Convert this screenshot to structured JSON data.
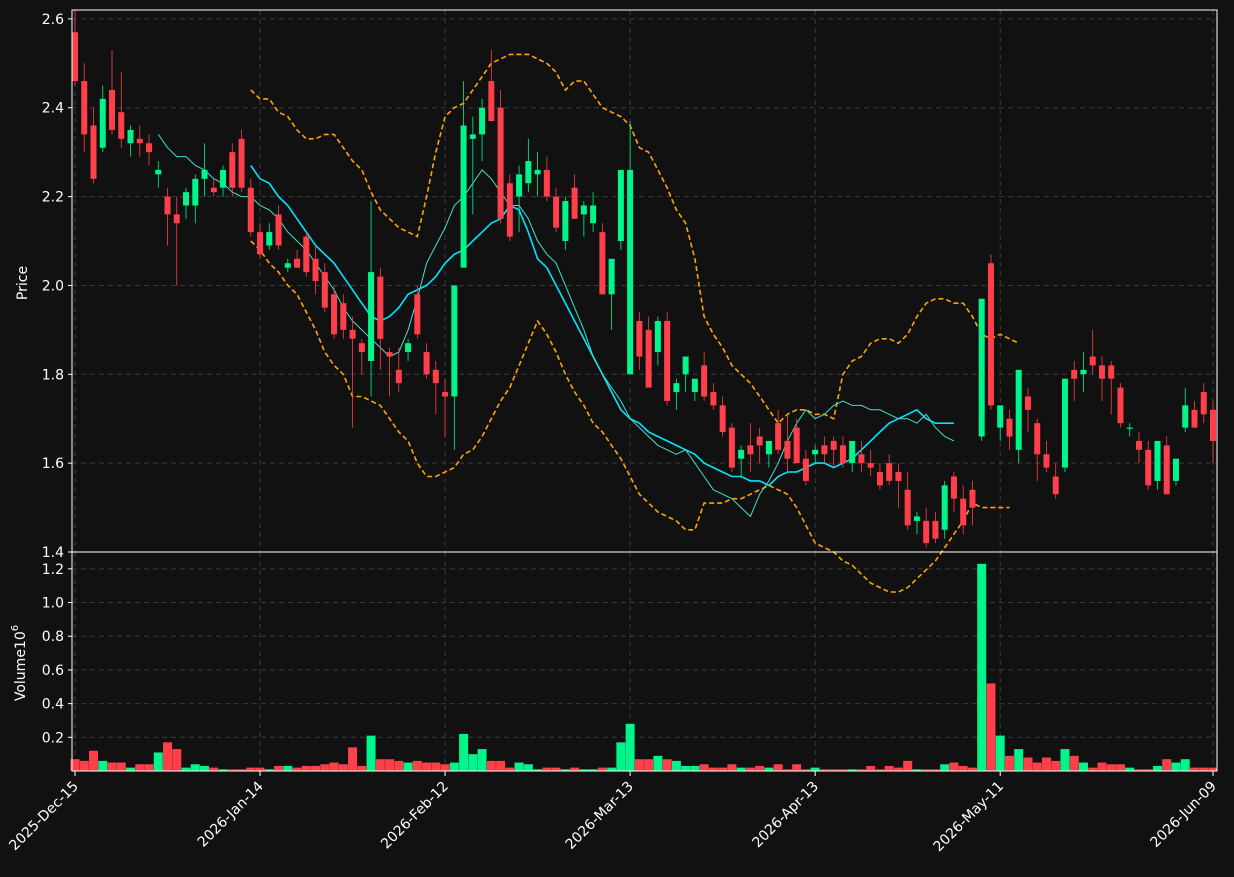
{
  "chart_data": {
    "type": "candlestick",
    "price_panel": {
      "ylabel": "Price",
      "ylim": [
        1.4,
        2.62
      ],
      "yticks": [
        "1.4",
        "1.6",
        "1.8",
        "2.0",
        "2.2",
        "2.4",
        "2.6"
      ],
      "grid": true
    },
    "volume_panel": {
      "ylabel": "Volume",
      "ylabel_exponent": "6",
      "ylim": [
        0,
        1.3
      ],
      "yticks": [
        "0.2",
        "0.4",
        "0.6",
        "0.8",
        "1.0",
        "1.2"
      ],
      "grid": true
    },
    "xtick_labels": [
      "2025-Dec-15",
      "2026-Jan-14",
      "2026-Feb-12",
      "2026-Mar-13",
      "2026-Apr-13",
      "2026-May-11",
      "2026-Jun-09"
    ],
    "xtick_indices": [
      0,
      20,
      40,
      60,
      80,
      100,
      123
    ],
    "candles": [
      [
        2.57,
        2.62,
        2.45,
        2.46,
        0.07
      ],
      [
        2.46,
        2.5,
        2.3,
        2.34,
        0.06
      ],
      [
        2.36,
        2.4,
        2.23,
        2.24,
        0.12
      ],
      [
        2.31,
        2.45,
        2.3,
        2.42,
        0.06
      ],
      [
        2.44,
        2.53,
        2.34,
        2.35,
        0.05
      ],
      [
        2.39,
        2.48,
        2.31,
        2.33,
        0.05
      ],
      [
        2.32,
        2.36,
        2.29,
        2.35,
        0.02
      ],
      [
        2.33,
        2.36,
        2.29,
        2.32,
        0.04
      ],
      [
        2.32,
        2.34,
        2.27,
        2.3,
        0.04
      ],
      [
        2.25,
        2.28,
        2.22,
        2.26,
        0.11
      ],
      [
        2.2,
        2.22,
        2.09,
        2.16,
        0.17
      ],
      [
        2.16,
        2.2,
        2.0,
        2.14,
        0.13
      ],
      [
        2.18,
        2.22,
        2.15,
        2.21,
        0.02
      ],
      [
        2.18,
        2.25,
        2.14,
        2.24,
        0.04
      ],
      [
        2.24,
        2.32,
        2.2,
        2.26,
        0.03
      ],
      [
        2.22,
        2.24,
        2.2,
        2.21,
        0.02
      ],
      [
        2.22,
        2.27,
        2.2,
        2.26,
        0.01
      ],
      [
        2.3,
        2.32,
        2.2,
        2.22,
        0.01
      ],
      [
        2.33,
        2.35,
        2.21,
        2.22,
        0.01
      ],
      [
        2.22,
        2.24,
        2.11,
        2.12,
        0.02
      ],
      [
        2.12,
        2.14,
        2.06,
        2.07,
        0.02
      ],
      [
        2.09,
        2.14,
        2.08,
        2.12,
        0.01
      ],
      [
        2.16,
        2.18,
        2.08,
        2.09,
        0.03
      ],
      [
        2.04,
        2.06,
        2.03,
        2.05,
        0.03
      ],
      [
        2.06,
        2.08,
        2.04,
        2.04,
        0.02
      ],
      [
        2.11,
        2.12,
        2.02,
        2.03,
        0.03
      ],
      [
        2.06,
        2.09,
        1.98,
        2.01,
        0.03
      ],
      [
        2.03,
        2.05,
        1.94,
        1.95,
        0.04
      ],
      [
        1.98,
        2.0,
        1.88,
        1.89,
        0.05
      ],
      [
        1.96,
        1.98,
        1.88,
        1.9,
        0.04
      ],
      [
        1.9,
        1.93,
        1.68,
        1.88,
        0.14
      ],
      [
        1.87,
        1.88,
        1.8,
        1.85,
        0.03
      ],
      [
        1.83,
        2.19,
        1.75,
        2.03,
        0.21
      ],
      [
        2.02,
        2.04,
        1.81,
        1.88,
        0.07
      ],
      [
        1.85,
        1.86,
        1.75,
        1.84,
        0.07
      ],
      [
        1.81,
        1.86,
        1.76,
        1.78,
        0.06
      ],
      [
        1.85,
        1.88,
        1.83,
        1.87,
        0.05
      ],
      [
        1.98,
        2.0,
        1.88,
        1.89,
        0.06
      ],
      [
        1.85,
        1.87,
        1.79,
        1.8,
        0.05
      ],
      [
        1.81,
        1.83,
        1.71,
        1.78,
        0.05
      ],
      [
        1.76,
        1.79,
        1.66,
        1.75,
        0.04
      ],
      [
        1.75,
        2.0,
        1.63,
        2.0,
        0.05
      ],
      [
        2.04,
        2.46,
        2.04,
        2.36,
        0.22
      ],
      [
        2.33,
        2.38,
        2.16,
        2.34,
        0.1
      ],
      [
        2.34,
        2.42,
        2.28,
        2.4,
        0.13
      ],
      [
        2.46,
        2.53,
        2.4,
        2.37,
        0.06
      ],
      [
        2.4,
        2.44,
        2.14,
        2.15,
        0.06
      ],
      [
        2.23,
        2.25,
        2.1,
        2.11,
        0.02
      ],
      [
        2.2,
        2.27,
        2.12,
        2.25,
        0.05
      ],
      [
        2.23,
        2.33,
        2.21,
        2.28,
        0.04
      ],
      [
        2.25,
        2.3,
        2.2,
        2.26,
        0.01
      ],
      [
        2.26,
        2.29,
        2.19,
        2.2,
        0.02
      ],
      [
        2.2,
        2.22,
        2.12,
        2.13,
        0.02
      ],
      [
        2.1,
        2.2,
        2.08,
        2.19,
        0.01
      ],
      [
        2.22,
        2.25,
        2.15,
        2.15,
        0.02
      ],
      [
        2.16,
        2.19,
        2.11,
        2.18,
        0.01
      ],
      [
        2.14,
        2.21,
        2.12,
        2.18,
        0.01
      ],
      [
        2.12,
        2.14,
        1.99,
        1.98,
        0.02
      ],
      [
        1.98,
        2.0,
        1.9,
        2.06,
        0.02
      ],
      [
        2.1,
        2.18,
        2.08,
        2.26,
        0.17
      ],
      [
        1.8,
        2.37,
        1.8,
        2.26,
        0.28
      ],
      [
        1.92,
        1.94,
        1.81,
        1.84,
        0.07
      ],
      [
        1.9,
        1.93,
        1.78,
        1.77,
        0.07
      ],
      [
        1.85,
        1.93,
        1.82,
        1.92,
        0.09
      ],
      [
        1.92,
        1.94,
        1.73,
        1.74,
        0.07
      ],
      [
        1.76,
        1.79,
        1.72,
        1.78,
        0.06
      ],
      [
        1.8,
        1.84,
        1.76,
        1.84,
        0.03
      ],
      [
        1.76,
        1.78,
        1.74,
        1.79,
        0.03
      ],
      [
        1.82,
        1.85,
        1.74,
        1.75,
        0.04
      ],
      [
        1.76,
        1.78,
        1.72,
        1.73,
        0.02
      ],
      [
        1.73,
        1.75,
        1.66,
        1.67,
        0.02
      ],
      [
        1.68,
        1.69,
        1.58,
        1.59,
        0.04
      ],
      [
        1.61,
        1.64,
        1.57,
        1.63,
        0.02
      ],
      [
        1.64,
        1.69,
        1.58,
        1.62,
        0.02
      ],
      [
        1.66,
        1.68,
        1.6,
        1.64,
        0.03
      ],
      [
        1.62,
        1.65,
        1.59,
        1.65,
        0.02
      ],
      [
        1.69,
        1.72,
        1.62,
        1.63,
        0.04
      ],
      [
        1.65,
        1.71,
        1.58,
        1.61,
        0.01
      ],
      [
        1.68,
        1.7,
        1.6,
        1.6,
        0.04
      ],
      [
        1.61,
        1.63,
        1.55,
        1.56,
        0.01
      ],
      [
        1.62,
        1.64,
        1.6,
        1.63,
        0.02
      ],
      [
        1.64,
        1.66,
        1.6,
        1.62,
        0.01
      ],
      [
        1.65,
        1.66,
        1.59,
        1.63,
        0.01
      ],
      [
        1.64,
        1.66,
        1.59,
        1.6,
        0.01
      ],
      [
        1.6,
        1.64,
        1.58,
        1.65,
        0.01
      ],
      [
        1.62,
        1.65,
        1.58,
        1.6,
        0.01
      ],
      [
        1.6,
        1.63,
        1.57,
        1.59,
        0.03
      ],
      [
        1.58,
        1.6,
        1.54,
        1.55,
        0.01
      ],
      [
        1.6,
        1.62,
        1.55,
        1.56,
        0.03
      ],
      [
        1.58,
        1.6,
        1.5,
        1.56,
        0.02
      ],
      [
        1.54,
        1.58,
        1.45,
        1.46,
        0.06
      ],
      [
        1.47,
        1.49,
        1.44,
        1.48,
        0.01
      ],
      [
        1.47,
        1.5,
        1.41,
        1.42,
        0.01
      ],
      [
        1.47,
        1.49,
        1.42,
        1.43,
        0.01
      ],
      [
        1.45,
        1.56,
        1.43,
        1.55,
        0.04
      ],
      [
        1.57,
        1.58,
        1.49,
        1.52,
        0.05
      ],
      [
        1.52,
        1.55,
        1.44,
        1.46,
        0.03
      ],
      [
        1.54,
        1.56,
        1.46,
        1.5,
        0.02
      ],
      [
        1.66,
        1.97,
        1.65,
        1.97,
        1.23
      ],
      [
        2.05,
        2.07,
        1.72,
        1.73,
        0.52
      ],
      [
        1.68,
        1.73,
        1.65,
        1.73,
        0.21
      ],
      [
        1.7,
        1.72,
        1.63,
        1.66,
        0.09
      ],
      [
        1.63,
        1.81,
        1.6,
        1.81,
        0.13
      ],
      [
        1.75,
        1.77,
        1.67,
        1.72,
        0.08
      ],
      [
        1.69,
        1.7,
        1.56,
        1.62,
        0.05
      ],
      [
        1.62,
        1.65,
        1.58,
        1.59,
        0.08
      ],
      [
        1.57,
        1.6,
        1.52,
        1.53,
        0.06
      ],
      [
        1.59,
        1.79,
        1.58,
        1.79,
        0.13
      ],
      [
        1.81,
        1.83,
        1.74,
        1.79,
        0.09
      ],
      [
        1.8,
        1.85,
        1.76,
        1.81,
        0.05
      ],
      [
        1.84,
        1.9,
        1.8,
        1.82,
        0.02
      ],
      [
        1.82,
        1.84,
        1.74,
        1.79,
        0.05
      ],
      [
        1.82,
        1.83,
        1.71,
        1.79,
        0.04
      ],
      [
        1.77,
        1.78,
        1.68,
        1.69,
        0.04
      ],
      [
        1.68,
        1.69,
        1.66,
        1.68,
        0.02
      ],
      [
        1.65,
        1.67,
        1.6,
        1.63,
        0.01
      ],
      [
        1.63,
        1.65,
        1.54,
        1.55,
        0.01
      ],
      [
        1.56,
        1.65,
        1.54,
        1.65,
        0.03
      ],
      [
        1.64,
        1.66,
        1.53,
        1.53,
        0.07
      ],
      [
        1.56,
        1.61,
        1.55,
        1.61,
        0.05
      ],
      [
        1.68,
        1.77,
        1.67,
        1.73,
        0.07
      ],
      [
        1.72,
        1.74,
        1.68,
        1.68,
        0.02
      ],
      [
        1.76,
        1.78,
        1.69,
        1.71,
        0.02
      ],
      [
        1.72,
        1.74,
        1.6,
        1.65,
        0.02
      ]
    ],
    "overlays": [
      {
        "kind": "bollinger_upper",
        "color": "#FFA500",
        "style": "dashed",
        "start_index": 19,
        "values": [
          2.44,
          2.42,
          2.42,
          2.39,
          2.38,
          2.35,
          2.33,
          2.33,
          2.34,
          2.34,
          2.31,
          2.28,
          2.26,
          2.21,
          2.17,
          2.15,
          2.13,
          2.12,
          2.11,
          2.2,
          2.3,
          2.38,
          2.4,
          2.41,
          2.44,
          2.47,
          2.5,
          2.51,
          2.52,
          2.52,
          2.52,
          2.51,
          2.5,
          2.48,
          2.44,
          2.46,
          2.46,
          2.43,
          2.4,
          2.39,
          2.38,
          2.36,
          2.31,
          2.3,
          2.26,
          2.22,
          2.17,
          2.14,
          2.06,
          1.93,
          1.89,
          1.86,
          1.82,
          1.8,
          1.78,
          1.75,
          1.72,
          1.69,
          1.71,
          1.72,
          1.72,
          1.71,
          1.71,
          1.7,
          1.8,
          1.83,
          1.84,
          1.87,
          1.88,
          1.88,
          1.87,
          1.89,
          1.93,
          1.96,
          1.97,
          1.97,
          1.96,
          1.96,
          1.93,
          1.89,
          1.88,
          1.89,
          1.88,
          1.87
        ]
      },
      {
        "kind": "bollinger_lower",
        "color": "#FFA500",
        "style": "dashed",
        "start_index": 19,
        "values": [
          2.1,
          2.08,
          2.05,
          2.03,
          2.0,
          1.98,
          1.94,
          1.9,
          1.85,
          1.82,
          1.8,
          1.75,
          1.75,
          1.74,
          1.73,
          1.7,
          1.67,
          1.65,
          1.6,
          1.57,
          1.57,
          1.58,
          1.59,
          1.62,
          1.63,
          1.66,
          1.7,
          1.74,
          1.77,
          1.82,
          1.87,
          1.92,
          1.89,
          1.85,
          1.8,
          1.76,
          1.73,
          1.69,
          1.67,
          1.64,
          1.61,
          1.57,
          1.53,
          1.51,
          1.49,
          1.48,
          1.47,
          1.45,
          1.45,
          1.51,
          1.51,
          1.51,
          1.52,
          1.52,
          1.53,
          1.54,
          1.55,
          1.54,
          1.53,
          1.5,
          1.46,
          1.42,
          1.41,
          1.4,
          1.38,
          1.37,
          1.35,
          1.33,
          1.32,
          1.31,
          1.31,
          1.32,
          1.34,
          1.36,
          1.38,
          1.41,
          1.44,
          1.47,
          1.51,
          1.5,
          1.5,
          1.5,
          1.5
        ]
      },
      {
        "kind": "moving_average_slow",
        "color": "#00E5FF",
        "style": "solid",
        "start_index": 19,
        "values": [
          2.27,
          2.24,
          2.23,
          2.2,
          2.18,
          2.15,
          2.12,
          2.09,
          2.07,
          2.05,
          2.02,
          1.99,
          1.96,
          1.93,
          1.92,
          1.93,
          1.95,
          1.98,
          1.99,
          2.0,
          2.02,
          2.05,
          2.07,
          2.08,
          2.1,
          2.12,
          2.14,
          2.15,
          2.18,
          2.17,
          2.12,
          2.06,
          2.04,
          2.0,
          1.96,
          1.92,
          1.88,
          1.84,
          1.8,
          1.76,
          1.72,
          1.7,
          1.69,
          1.67,
          1.66,
          1.65,
          1.64,
          1.63,
          1.62,
          1.6,
          1.59,
          1.58,
          1.57,
          1.57,
          1.56,
          1.56,
          1.55,
          1.57,
          1.58,
          1.58,
          1.59,
          1.6,
          1.6,
          1.59,
          1.6,
          1.61,
          1.63,
          1.65,
          1.67,
          1.69,
          1.7,
          1.71,
          1.72,
          1.7,
          1.69,
          1.69,
          1.69
        ]
      },
      {
        "kind": "moving_average_fast",
        "color": "#40E0D0",
        "style": "solid",
        "start_index": 9,
        "values": [
          2.34,
          2.31,
          2.29,
          2.29,
          2.27,
          2.26,
          2.24,
          2.23,
          2.21,
          2.2,
          2.2,
          2.18,
          2.17,
          2.15,
          2.12,
          2.1,
          2.08,
          2.05,
          2.02,
          1.99,
          1.95,
          1.92,
          1.9,
          1.88,
          1.86,
          1.84,
          1.85,
          1.9,
          1.97,
          2.05,
          2.09,
          2.13,
          2.18,
          2.2,
          2.23,
          2.26,
          2.24,
          2.21,
          2.18,
          2.18,
          2.15,
          2.1,
          2.07,
          2.05,
          2.0,
          1.95,
          1.9,
          1.84,
          1.8,
          1.77,
          1.74,
          1.7,
          1.68,
          1.66,
          1.64,
          1.63,
          1.62,
          1.63,
          1.6,
          1.57,
          1.54,
          1.53,
          1.52,
          1.5,
          1.48,
          1.53,
          1.56,
          1.6,
          1.65,
          1.69,
          1.72,
          1.7,
          1.71,
          1.73,
          1.74,
          1.73,
          1.73,
          1.72,
          1.72,
          1.71,
          1.7,
          1.7,
          1.69,
          1.71,
          1.68,
          1.66,
          1.65
        ]
      }
    ],
    "colors": {
      "up": "#00F58A",
      "down": "#FF3F4A",
      "background": "#111111",
      "grid": "#3A3A3A",
      "axes": "#FFFFFF"
    }
  }
}
